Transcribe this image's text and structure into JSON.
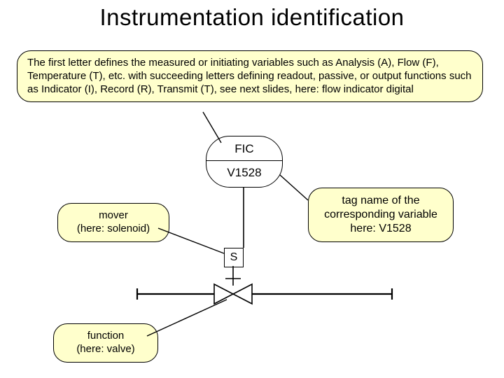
{
  "title": "Instrumentation identification",
  "description_box": "The first letter defines the measured or initiating variables such as Analysis (A), Flow (F), Temperature (T), etc. with succeeding letters defining readout, passive, or output functions such as Indicator (I), Record (R), Transmit (T), see next slides, here: flow indicator digital",
  "instrument": {
    "code": "FIC",
    "tag": "V1528"
  },
  "actuator_letter": "S",
  "callouts": {
    "mover": "mover\n(here: solenoid)",
    "function": "function\n(here: valve)",
    "tagname": "tag name of the corresponding variable\nhere: V1528"
  }
}
